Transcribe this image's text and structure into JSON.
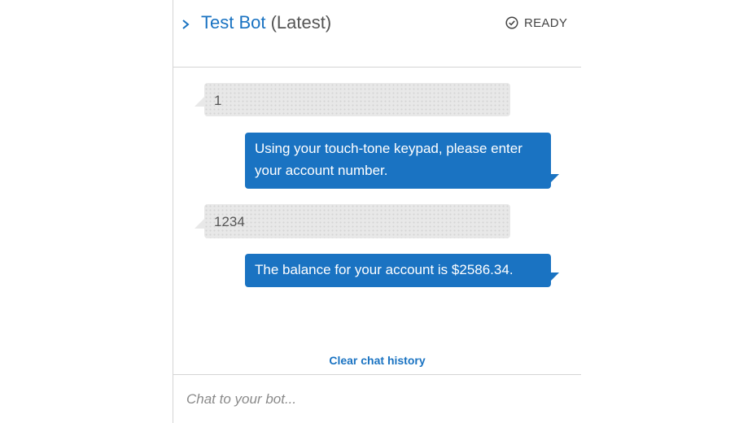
{
  "header": {
    "bot_name": "Test Bot",
    "version": "(Latest)",
    "status": "READY",
    "expand_icon": "chevron-right-icon",
    "status_icon": "check-circle-icon"
  },
  "messages": [
    {
      "sender": "user",
      "text": "1"
    },
    {
      "sender": "bot",
      "text": "Using your touch-tone keypad, please enter your account number."
    },
    {
      "sender": "user",
      "text": "1234"
    },
    {
      "sender": "bot",
      "text": "The balance for your account is $2586.34."
    }
  ],
  "clear_history_label": "Clear chat history",
  "input": {
    "placeholder": "Chat to your bot...",
    "value": ""
  },
  "colors": {
    "accent": "#1a73c2",
    "user_bubble": "#e8e8e8",
    "divider": "#d5d5d5"
  }
}
